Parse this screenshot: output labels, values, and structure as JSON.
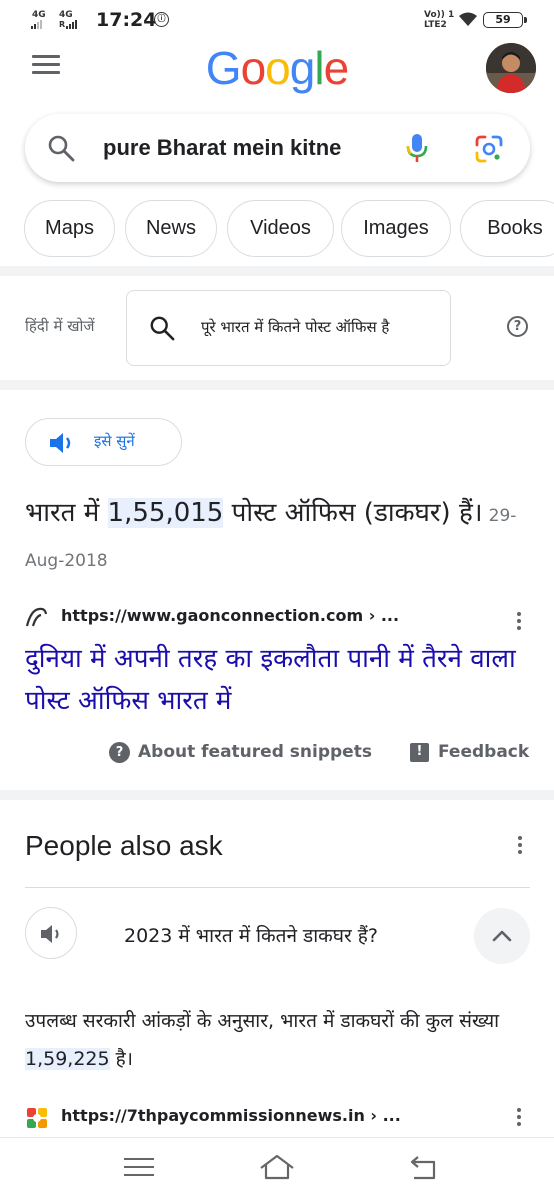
{
  "status_bar": {
    "network_1": "4G",
    "network_2": "4G",
    "network_2_sub": "R",
    "time": "17:24",
    "volte_1": "Vo)) 1",
    "volte_2": "LTE2",
    "battery": "59"
  },
  "header": {
    "logo_letters": [
      {
        "char": "G",
        "color": "#4285F4"
      },
      {
        "char": "o",
        "color": "#EA4335"
      },
      {
        "char": "o",
        "color": "#FBBC05"
      },
      {
        "char": "g",
        "color": "#4285F4"
      },
      {
        "char": "l",
        "color": "#34A853"
      },
      {
        "char": "e",
        "color": "#EA4335"
      }
    ]
  },
  "search": {
    "query": "pure Bharat mein kitne"
  },
  "chips": [
    "Maps",
    "News",
    "Videos",
    "Images",
    "Books"
  ],
  "hindi_search": {
    "label": "हिंदी में खोजें",
    "query": "पूरे भारत में कितने पोस्ट ऑफिस है"
  },
  "featured_snippet": {
    "listen_label": "इसे सुनें",
    "answer_pre": "भारत में ",
    "answer_highlight": "1,55,015",
    "answer_post": " पोस्ट ऑफिस (डाकघर) हैं।",
    "date": "29-Aug-2018",
    "source_url": "https://www.gaonconnection.com › ...",
    "title": "दुनिया में अपनी तरह का इकलौता पानी में तैरने वाला पोस्ट ऑफिस भारत में",
    "about_label": "About featured snippets",
    "feedback_label": "Feedback"
  },
  "people_also_ask": {
    "title": "People also ask",
    "question": "2023 में भारत में कितने डाकघर हैं?",
    "answer_pre": "उपलब्ध सरकारी आंकड़ों के अनुसार, भारत में डाकघरों की कुल संख्या ",
    "answer_highlight": "1,59,225",
    "answer_post": " है।",
    "source_url": "https://7thpaycommissionnews.in › ..."
  },
  "colors": {
    "link": "#1a0dab",
    "accent_blue": "#1a73e8",
    "highlight": "#e8f0fe"
  }
}
